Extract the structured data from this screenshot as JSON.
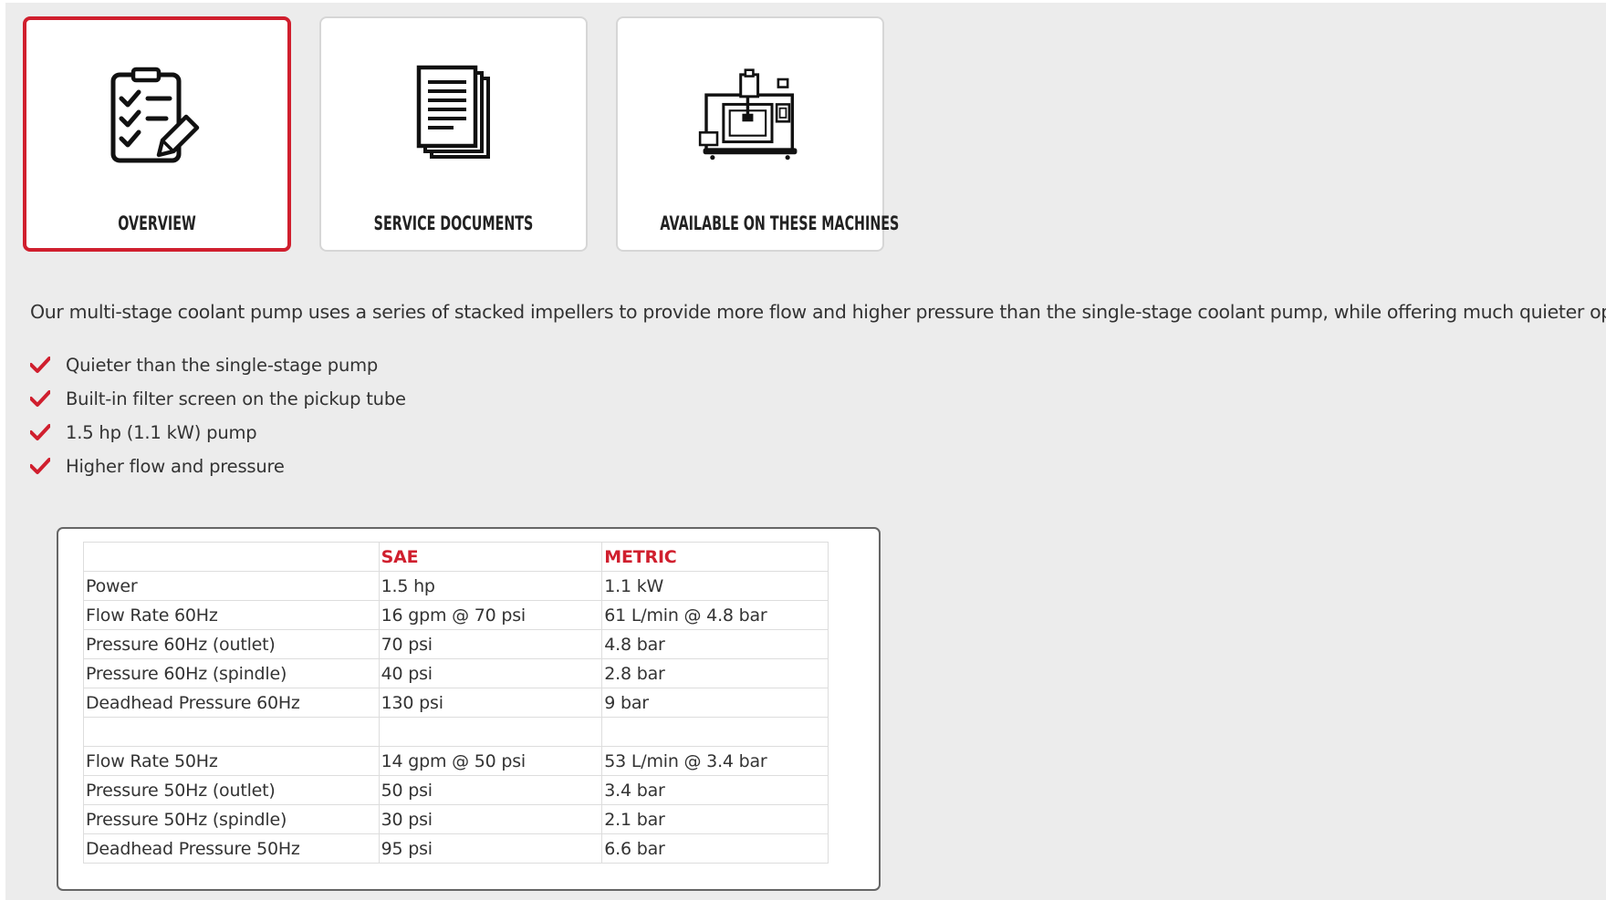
{
  "tabs": [
    {
      "label": "OVERVIEW",
      "icon": "checklist-icon",
      "active": true
    },
    {
      "label": "SERVICE DOCUMENTS",
      "icon": "documents-icon",
      "active": false
    },
    {
      "label": "AVAILABLE ON THESE MACHINES",
      "icon": "cnc-machine-icon",
      "active": false
    }
  ],
  "overview": {
    "intro": "Our multi-stage coolant pump uses a series of stacked impellers to provide more flow and higher pressure than the single-stage coolant pump, while offering much quieter operation.",
    "features": [
      "Quieter than the single-stage pump",
      "Built-in filter screen on the pickup tube",
      "1.5 hp (1.1 kW) pump",
      "Higher flow and pressure"
    ],
    "feature_icon": "checkmark-icon"
  },
  "specs": {
    "headers": [
      "",
      "SAE",
      "METRIC"
    ],
    "rows": [
      [
        "Power",
        "1.5 hp",
        "1.1 kW"
      ],
      [
        "Flow Rate 60Hz",
        "16 gpm @ 70 psi",
        "61 L/min @ 4.8 bar"
      ],
      [
        "Pressure 60Hz (outlet)",
        "70 psi",
        "4.8 bar"
      ],
      [
        "Pressure 60Hz (spindle)",
        "40 psi",
        "2.8 bar"
      ],
      [
        "Deadhead Pressure 60Hz",
        "130 psi",
        "9 bar"
      ],
      [
        "",
        "",
        ""
      ],
      [
        "Flow Rate 50Hz",
        "14 gpm @ 50 psi",
        "53 L/min @ 3.4 bar"
      ],
      [
        "Pressure 50Hz (outlet)",
        "50 psi",
        "3.4 bar"
      ],
      [
        "Pressure 50Hz (spindle)",
        "30 psi",
        "2.1 bar"
      ],
      [
        "Deadhead Pressure 50Hz",
        "95 psi",
        "6.6 bar"
      ]
    ]
  },
  "colors": {
    "accent": "#d01f2e",
    "panel_background": "#ececec",
    "card_background": "#ffffff",
    "text": "#333333"
  }
}
